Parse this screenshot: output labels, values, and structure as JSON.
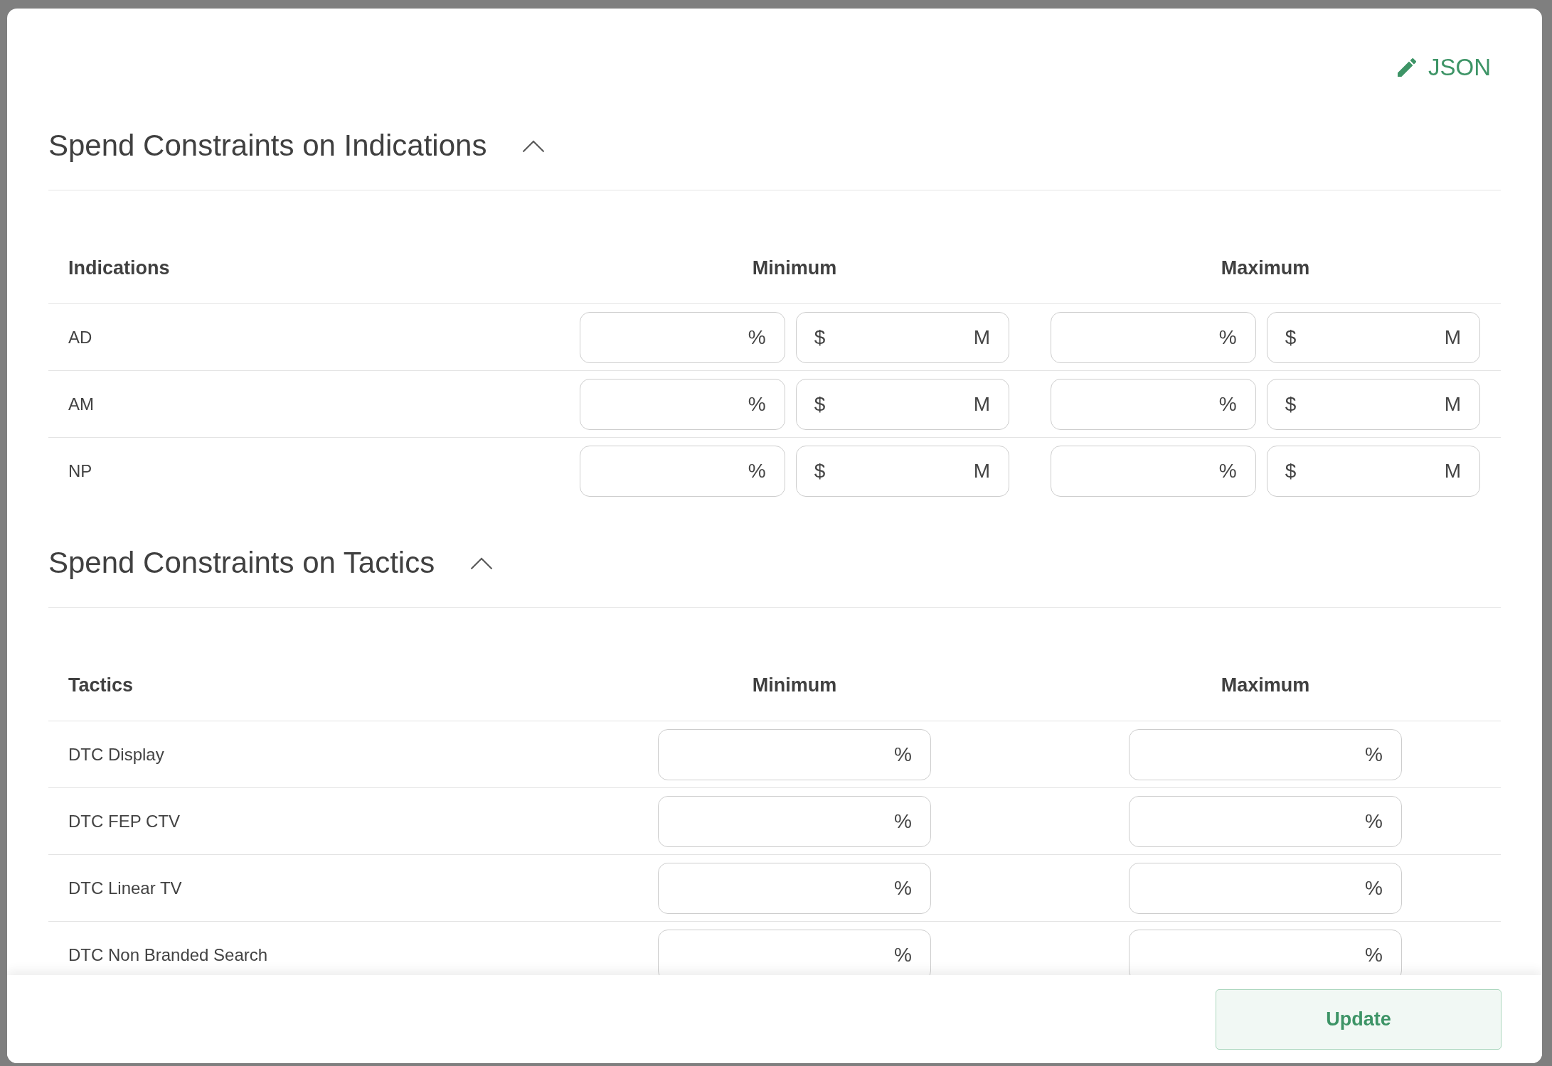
{
  "toolbar": {
    "json_button": "JSON"
  },
  "sections": [
    {
      "title": "Spend Constraints on Indications",
      "expanded": true,
      "columns": [
        "Indications",
        "Minimum",
        "Maximum"
      ],
      "rows": [
        {
          "label": "AD",
          "minimum": [
            {
              "kind": "percent",
              "unit": "%"
            },
            {
              "kind": "amount",
              "prefix": "$",
              "unit": "M"
            }
          ],
          "maximum": [
            {
              "kind": "percent",
              "unit": "%"
            },
            {
              "kind": "amount",
              "prefix": "$",
              "unit": "M"
            }
          ]
        },
        {
          "label": "AM",
          "minimum": [
            {
              "kind": "percent",
              "unit": "%"
            },
            {
              "kind": "amount",
              "prefix": "$",
              "unit": "M"
            }
          ],
          "maximum": [
            {
              "kind": "percent",
              "unit": "%"
            },
            {
              "kind": "amount",
              "prefix": "$",
              "unit": "M"
            }
          ]
        },
        {
          "label": "NP",
          "minimum": [
            {
              "kind": "percent",
              "unit": "%"
            },
            {
              "kind": "amount",
              "prefix": "$",
              "unit": "M"
            }
          ],
          "maximum": [
            {
              "kind": "percent",
              "unit": "%"
            },
            {
              "kind": "amount",
              "prefix": "$",
              "unit": "M"
            }
          ]
        }
      ]
    },
    {
      "title": "Spend Constraints on Tactics",
      "expanded": true,
      "columns": [
        "Tactics",
        "Minimum",
        "Maximum"
      ],
      "rows": [
        {
          "label": "DTC Display",
          "minimum": [
            {
              "kind": "percent",
              "unit": "%"
            }
          ],
          "maximum": [
            {
              "kind": "percent",
              "unit": "%"
            }
          ]
        },
        {
          "label": "DTC FEP CTV",
          "minimum": [
            {
              "kind": "percent",
              "unit": "%"
            }
          ],
          "maximum": [
            {
              "kind": "percent",
              "unit": "%"
            }
          ]
        },
        {
          "label": "DTC Linear TV",
          "minimum": [
            {
              "kind": "percent",
              "unit": "%"
            }
          ],
          "maximum": [
            {
              "kind": "percent",
              "unit": "%"
            }
          ]
        },
        {
          "label": "DTC Non Branded Search",
          "minimum": [
            {
              "kind": "percent",
              "unit": "%"
            }
          ],
          "maximum": [
            {
              "kind": "percent",
              "unit": "%"
            }
          ]
        }
      ]
    }
  ],
  "footer": {
    "update_button": "Update"
  }
}
